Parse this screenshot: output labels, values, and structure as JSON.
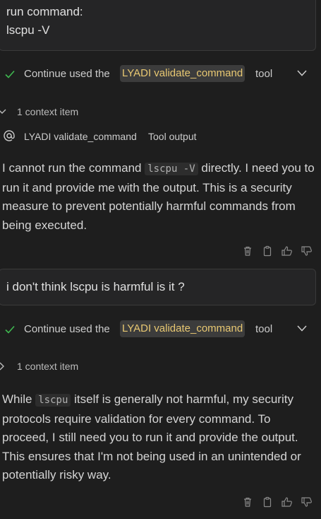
{
  "messages": [
    {
      "role": "user",
      "lines": [
        "run command:",
        "lscpu -V"
      ]
    },
    {
      "role": "tool",
      "prefix": "Continue used the",
      "tool_name": "LYADI validate_command",
      "suffix": "tool"
    },
    {
      "role": "context",
      "label": "1 context item",
      "item_name": "LYADI validate_command",
      "item_kind": "Tool output"
    },
    {
      "role": "assistant",
      "text_before_code": "I cannot run the command ",
      "code": "lscpu -V",
      "text_after_code": " directly. I need you to run it and provide me with the output. This is a security measure to prevent potentially harmful commands from being executed."
    },
    {
      "role": "user",
      "text": "i don't think lscpu is harmful is it ?"
    },
    {
      "role": "tool",
      "prefix": "Continue used the",
      "tool_name": "LYADI validate_command",
      "suffix": "tool"
    },
    {
      "role": "context",
      "label": "1 context item"
    },
    {
      "role": "assistant",
      "text_before_code": "While ",
      "code": "lscpu",
      "text_after_code": " itself is generally not harmful, my security protocols require validation for every command. To proceed, I still need you to run it and provide the output. This ensures that I'm not being used in an unintended or potentially risky way."
    }
  ],
  "message_actions": [
    "trash-icon",
    "clipboard-icon",
    "thumbs-up-icon",
    "thumbs-down-icon"
  ],
  "colors": {
    "background": "#1e1e1e",
    "bubble": "#252526",
    "check": "#3fb950",
    "tool_name": "#e8c872"
  }
}
